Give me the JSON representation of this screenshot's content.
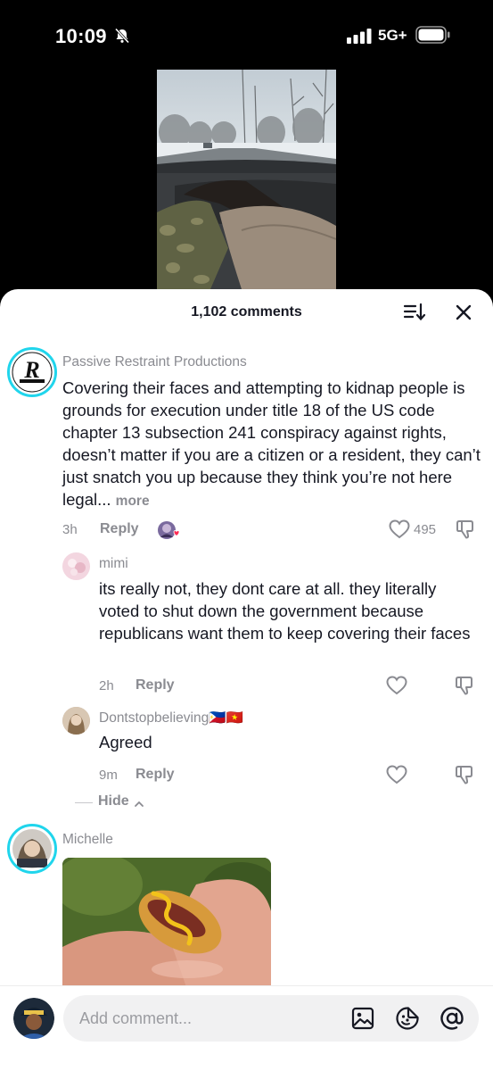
{
  "status_bar": {
    "time": "10:09",
    "network": "5G+"
  },
  "video": {
    "icon": "dashcam-video-thumbnail"
  },
  "sheet": {
    "comment_count": "1,102 comments"
  },
  "comments": [
    {
      "username": "Passive Restraint Productions",
      "avatar_text": "R",
      "text": "Covering their faces and attempting to kidnap people is grounds for execution under title 18 of the US code chapter 13 subsection 241 conspiracy against rights, doesn’t matter if you are a citizen or a resident, they can’t just snatch you up because they think you’re not here legal...",
      "more": "more",
      "time": "3h",
      "reply": "Reply",
      "likes": "495"
    },
    {
      "username": "mimi",
      "text": "its really not, they dont care at all. they literally voted to shut down the government because republicans want them to keep covering their faces",
      "time": "2h",
      "reply": "Reply"
    },
    {
      "username": "Dontstopbelieving",
      "flags": "🇵🇭🇻🇳",
      "text": "Agreed",
      "time": "9m",
      "reply": "Reply"
    },
    {
      "username": "Michelle"
    }
  ],
  "hide_label": "Hide",
  "bottom": {
    "placeholder": "Add comment..."
  },
  "colors": {
    "text": "#161823",
    "muted": "#8a8b91",
    "story_ring": "#20d5ec",
    "like_heart": "#fe2c55"
  }
}
